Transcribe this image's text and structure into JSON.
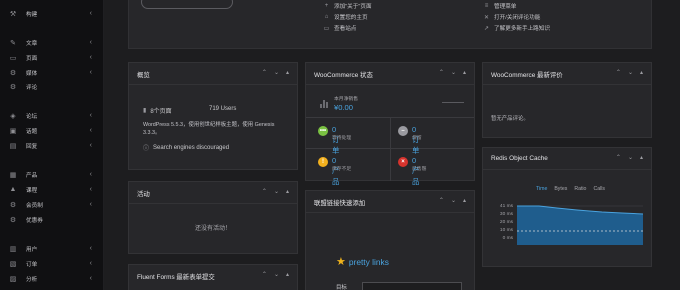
{
  "sidebar": {
    "items": [
      {
        "label": "构建",
        "icon": "hammer-icon",
        "has_chevron": true
      },
      {
        "label": "文章",
        "icon": "pin-icon",
        "has_chevron": true
      },
      {
        "label": "页面",
        "icon": "page-icon",
        "has_chevron": true
      },
      {
        "label": "媒体",
        "icon": "gear-icon",
        "has_chevron": true
      },
      {
        "label": "评论",
        "icon": "gear-icon",
        "has_chevron": false
      },
      {
        "label": "论坛",
        "icon": "forum-icon",
        "has_chevron": true
      },
      {
        "label": "话题",
        "icon": "topic-icon",
        "has_chevron": true
      },
      {
        "label": "回复",
        "icon": "reply-icon",
        "has_chevron": true
      },
      {
        "label": "产品",
        "icon": "box-icon",
        "has_chevron": true
      },
      {
        "label": "课程",
        "icon": "graduation-cap-icon",
        "has_chevron": true
      },
      {
        "label": "会员制",
        "icon": "gear-icon",
        "has_chevron": true
      },
      {
        "label": "优惠券",
        "icon": "gear-icon",
        "has_chevron": false
      },
      {
        "label": "用户",
        "icon": "user-icon",
        "has_chevron": true
      },
      {
        "label": "订单",
        "icon": "orders-icon",
        "has_chevron": true
      },
      {
        "label": "分析",
        "icon": "analytics-icon",
        "has_chevron": true
      }
    ]
  },
  "welcome": {
    "links_mid": [
      {
        "label": "添加\"关于\"页面",
        "icon": "plus-icon"
      },
      {
        "label": "设置您的主页",
        "icon": "home-icon"
      },
      {
        "label": "查看站点",
        "icon": "monitor-icon"
      }
    ],
    "links_right": [
      {
        "label": "管理菜单",
        "icon": "menu-icon"
      },
      {
        "label": "打开/关闭评论功能",
        "icon": "comment-icon"
      },
      {
        "label": "了解更多新手上路知识",
        "icon": "flag-icon"
      }
    ]
  },
  "overview": {
    "title": "概览",
    "pages": "8个页面",
    "users": "719 Users",
    "version_text": "WordPress 5.5.3，使用创世纪样板主题，使用 Genesis 3.3.3。",
    "discouraged": "Search engines discouraged"
  },
  "activity": {
    "title": "活动",
    "empty": "还没有活动！"
  },
  "fluent_forms": {
    "title": "Fluent Forms 最新表单提交"
  },
  "woo_status": {
    "title": "WooCommerce 状态",
    "net_sales_label": "本月净销售",
    "net_sales_value": "¥0.00",
    "cells": [
      {
        "value": "0 订单",
        "label": "等待处理",
        "color": "#7ac142",
        "symbol": "•••"
      },
      {
        "value": "0 订单",
        "label": "保留",
        "color": "#9a9aa0",
        "symbol": "–"
      },
      {
        "value": "0 产品",
        "label": "库存不足",
        "color": "#f2b01e",
        "symbol": "!"
      },
      {
        "value": "0 产品",
        "label": "已售罄",
        "color": "#d6332d",
        "symbol": "×"
      }
    ]
  },
  "affiliate": {
    "title": "联盟链接快速添加",
    "brand": "pretty links",
    "field_label": "目标"
  },
  "woo_reviews": {
    "title": "WooCommerce 最新评价",
    "empty": "暂无产品评论。"
  },
  "redis": {
    "title": "Redis Object Cache",
    "tabs": [
      "Time",
      "Bytes",
      "Ratio",
      "Calls"
    ],
    "active_tab": "Time",
    "y_ticks": [
      "41 ms",
      "30 ms",
      "20 ms",
      "10 ms",
      "0 ms"
    ],
    "accent": "#4aa3df"
  },
  "colors": {
    "background": "#1d1d1f",
    "card": "#27272a",
    "sidebar": "#101012",
    "link": "#4aa3df"
  }
}
